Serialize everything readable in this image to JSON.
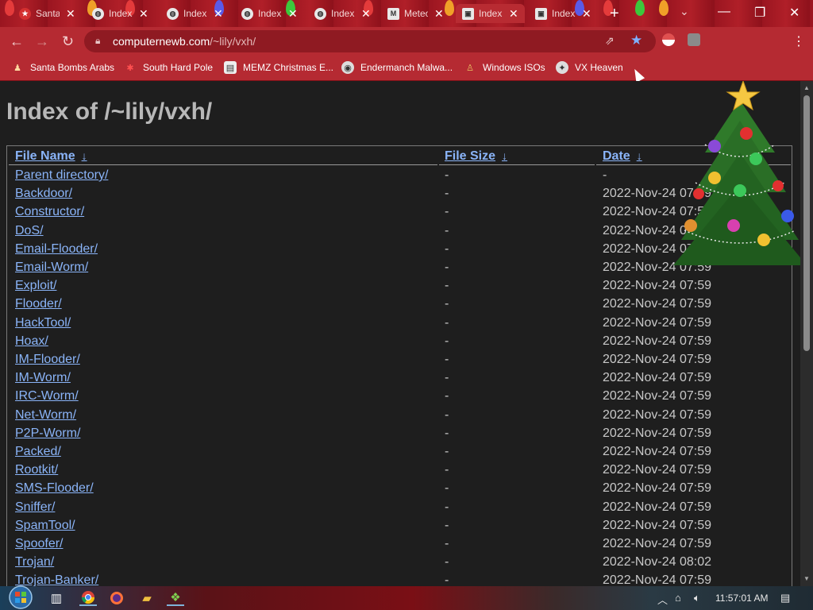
{
  "browser": {
    "tabs": [
      {
        "label": "Santa",
        "favicon": "santa-icon"
      },
      {
        "label": "Index",
        "favicon": "globe-icon"
      },
      {
        "label": "Index",
        "favicon": "globe-icon"
      },
      {
        "label": "Index",
        "favicon": "globe-icon"
      },
      {
        "label": "Index",
        "favicon": "globe-icon"
      },
      {
        "label": "Meteor",
        "favicon": "m-icon"
      },
      {
        "label": "Index",
        "favicon": "page-icon"
      },
      {
        "label": "Index",
        "favicon": "page-icon"
      }
    ],
    "new_tab": "+",
    "address": {
      "host": "computernewb.com",
      "path": "/~lily/vxh/"
    },
    "bookmarks": [
      {
        "label": "Santa Bombs Arabs",
        "icon": "santa-icon"
      },
      {
        "label": "South Hard Pole",
        "icon": "snowflake-icon"
      },
      {
        "label": "MEMZ Christmas E...",
        "icon": "page-icon"
      },
      {
        "label": "Endermanch Malwa...",
        "icon": "raccoon-icon"
      },
      {
        "label": "Windows ISOs",
        "icon": "figure-icon"
      },
      {
        "label": "VX Heaven",
        "icon": "vx-icon"
      }
    ]
  },
  "page": {
    "title": "Index of /~lily/vxh/",
    "columns": {
      "name": "File Name",
      "size": "File Size",
      "date": "Date",
      "sort_arrow": "↓"
    },
    "rows": [
      {
        "name": "Parent directory/",
        "size": "-",
        "date": "-"
      },
      {
        "name": "Backdoor/",
        "size": "-",
        "date": "2022-Nov-24 07:59"
      },
      {
        "name": "Constructor/",
        "size": "-",
        "date": "2022-Nov-24 07:59"
      },
      {
        "name": "DoS/",
        "size": "-",
        "date": "2022-Nov-24 07:59"
      },
      {
        "name": "Email-Flooder/",
        "size": "-",
        "date": "2022-Nov-24 07:59"
      },
      {
        "name": "Email-Worm/",
        "size": "-",
        "date": "2022-Nov-24 07:59"
      },
      {
        "name": "Exploit/",
        "size": "-",
        "date": "2022-Nov-24 07:59"
      },
      {
        "name": "Flooder/",
        "size": "-",
        "date": "2022-Nov-24 07:59"
      },
      {
        "name": "HackTool/",
        "size": "-",
        "date": "2022-Nov-24 07:59"
      },
      {
        "name": "Hoax/",
        "size": "-",
        "date": "2022-Nov-24 07:59"
      },
      {
        "name": "IM-Flooder/",
        "size": "-",
        "date": "2022-Nov-24 07:59"
      },
      {
        "name": "IM-Worm/",
        "size": "-",
        "date": "2022-Nov-24 07:59"
      },
      {
        "name": "IRC-Worm/",
        "size": "-",
        "date": "2022-Nov-24 07:59"
      },
      {
        "name": "Net-Worm/",
        "size": "-",
        "date": "2022-Nov-24 07:59"
      },
      {
        "name": "P2P-Worm/",
        "size": "-",
        "date": "2022-Nov-24 07:59"
      },
      {
        "name": "Packed/",
        "size": "-",
        "date": "2022-Nov-24 07:59"
      },
      {
        "name": "Rootkit/",
        "size": "-",
        "date": "2022-Nov-24 07:59"
      },
      {
        "name": "SMS-Flooder/",
        "size": "-",
        "date": "2022-Nov-24 07:59"
      },
      {
        "name": "Sniffer/",
        "size": "-",
        "date": "2022-Nov-24 07:59"
      },
      {
        "name": "SpamTool/",
        "size": "-",
        "date": "2022-Nov-24 07:59"
      },
      {
        "name": "Spoofer/",
        "size": "-",
        "date": "2022-Nov-24 07:59"
      },
      {
        "name": "Trojan/",
        "size": "-",
        "date": "2022-Nov-24 08:02"
      },
      {
        "name": "Trojan-Banker/",
        "size": "-",
        "date": "2022-Nov-24 07:59"
      }
    ]
  },
  "taskbar": {
    "clock": "11:57:01 AM",
    "apps": [
      "start-orb-icon",
      "task-view-icon",
      "chrome-icon",
      "firefox-icon",
      "folder-icon",
      "app-icon"
    ]
  },
  "colors": {
    "link": "#8ab4f8",
    "chrome_red": "#b52a32",
    "page_bg": "#1e1e1e"
  }
}
